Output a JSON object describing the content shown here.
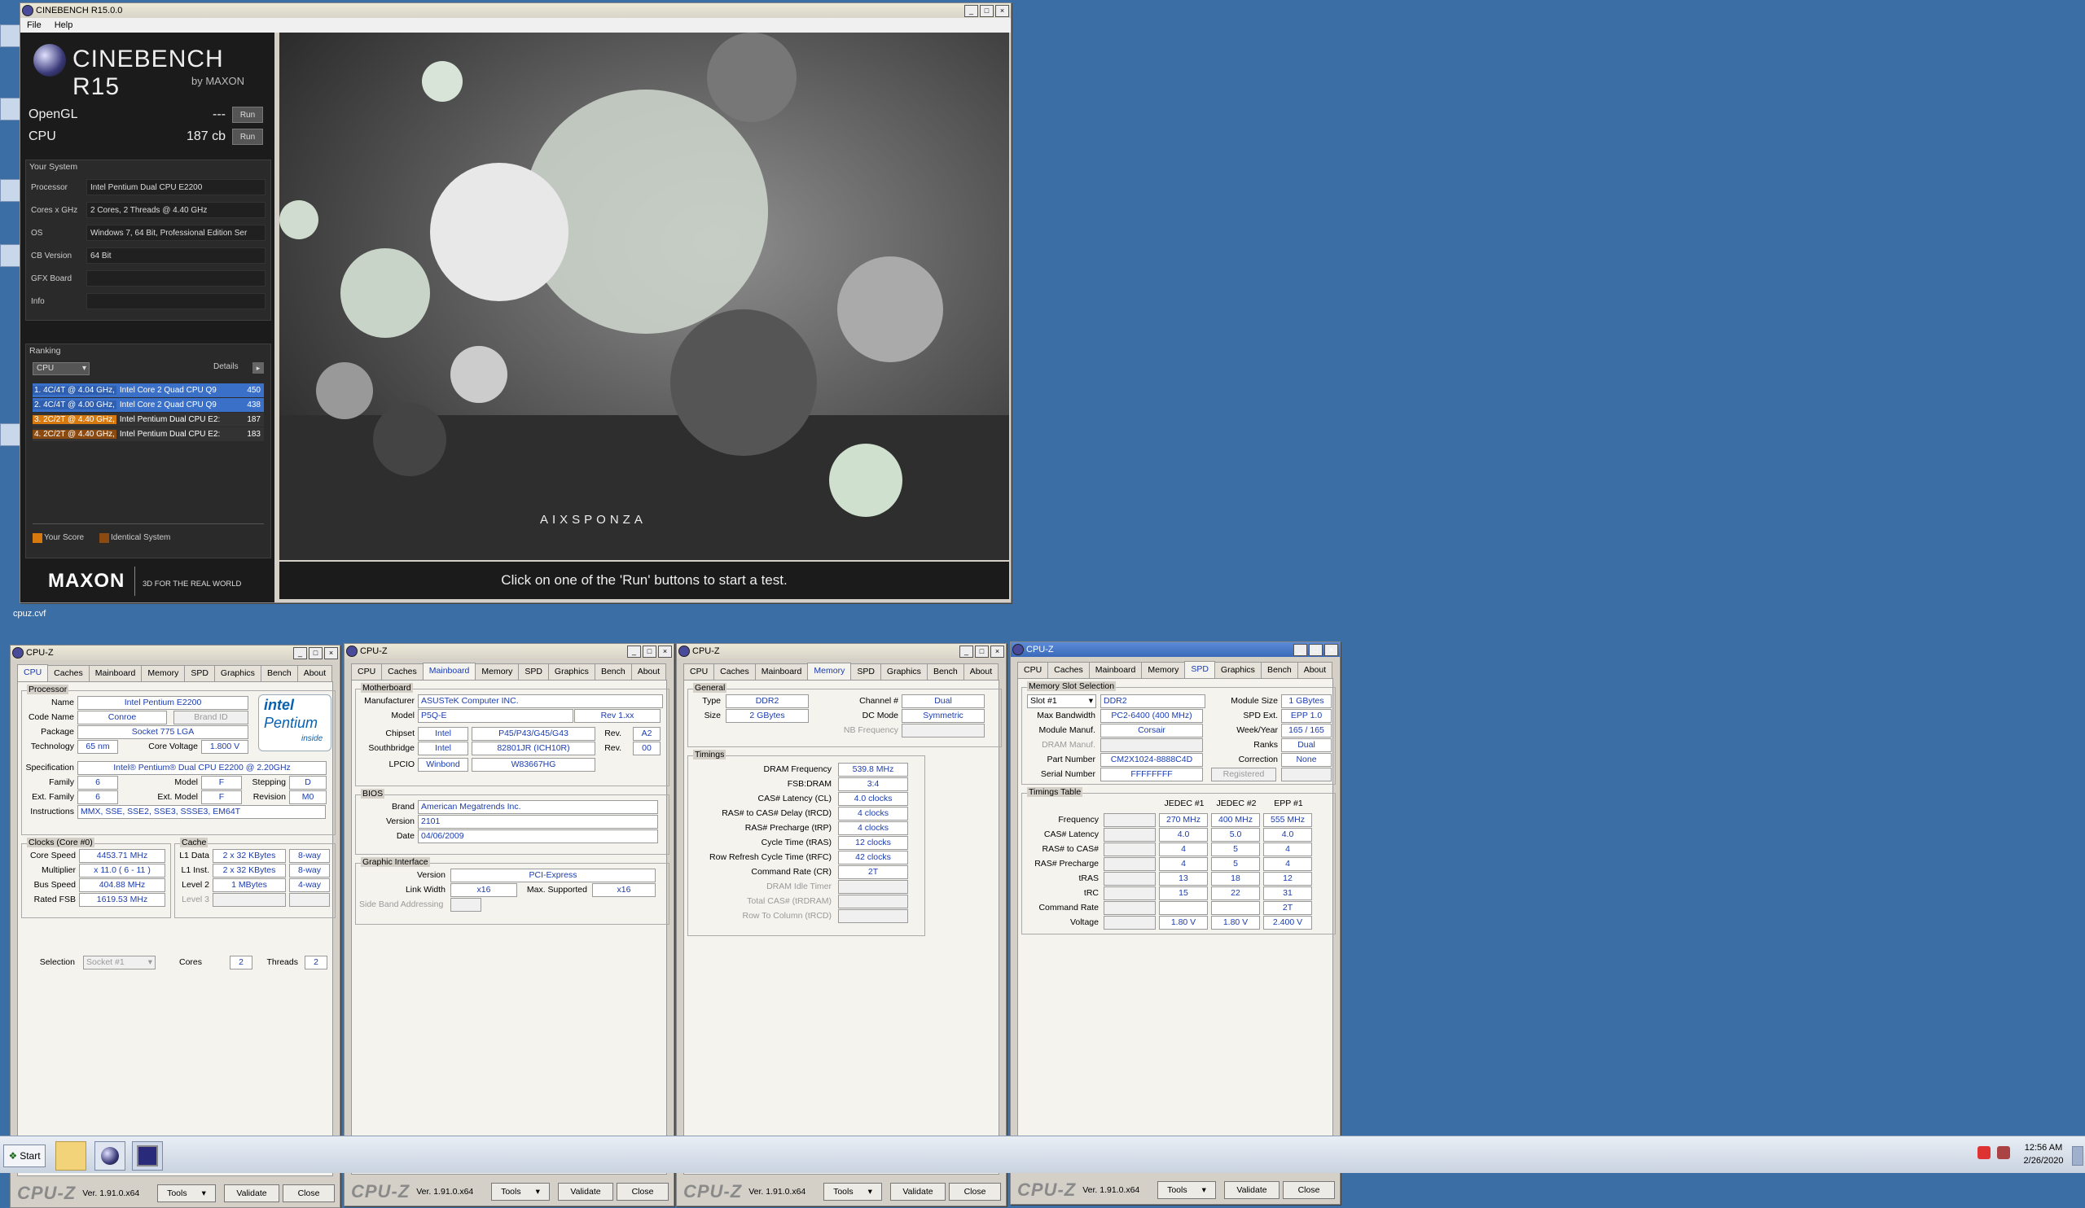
{
  "desktop": {
    "file_label": "cpuz.cvf"
  },
  "cinebench": {
    "title": "CINEBENCH R15.0.0",
    "menu": [
      "File",
      "Help"
    ],
    "logo_main": "CINEBENCH R15",
    "logo_sub": "by MAXON",
    "opengl_label": "OpenGL",
    "opengl_value": "---",
    "cpu_label": "CPU",
    "cpu_value": "187 cb",
    "run_label": "Run",
    "your_system": "Your System",
    "system": [
      {
        "k": "Processor",
        "v": "Intel Pentium Dual CPU E2200"
      },
      {
        "k": "Cores x GHz",
        "v": "2 Cores, 2 Threads @ 4.40 GHz"
      },
      {
        "k": "OS",
        "v": "Windows 7, 64 Bit, Professional Edition Ser"
      },
      {
        "k": "CB Version",
        "v": "64 Bit"
      },
      {
        "k": "GFX Board",
        "v": ""
      },
      {
        "k": "Info",
        "v": ""
      }
    ],
    "ranking_label": "Ranking",
    "ranking_select": "CPU",
    "details_label": "Details",
    "ranking": [
      {
        "hl": "1. 4C/4T @ 4.04 GHz,",
        "t": " Intel Core 2 Quad CPU Q9",
        "s": "450",
        "kind": "blue"
      },
      {
        "hl": "2. 4C/4T @ 4.00 GHz,",
        "t": " Intel Core 2 Quad CPU Q9",
        "s": "438",
        "kind": "blue"
      },
      {
        "hl": "3. 2C/2T @ 4.40 GHz,",
        "t": " Intel Pentium Dual CPU E2:",
        "s": "187",
        "kind": "orange"
      },
      {
        "hl": "4. 2C/2T @ 4.40 GHz,",
        "t": " Intel Pentium Dual CPU E2:",
        "s": "183",
        "kind": "brown"
      }
    ],
    "legend_your": "Your Score",
    "legend_ident": "Identical System",
    "maxon": "MAXON",
    "tagline": "3D FOR THE REAL WORLD",
    "status": "Click on one of the 'Run' buttons to start a test.",
    "render_credit": "AIXSPONZA"
  },
  "cpuz_common": {
    "title": "CPU-Z",
    "tabs": [
      "CPU",
      "Caches",
      "Mainboard",
      "Memory",
      "SPD",
      "Graphics",
      "Bench",
      "About"
    ],
    "logo": "CPU-Z",
    "version": "Ver. 1.91.0.x64",
    "tools": "Tools",
    "validate": "Validate",
    "close": "Close"
  },
  "cpuz_cpu": {
    "processor": "Processor",
    "name_l": "Name",
    "name": "Intel Pentium E2200",
    "codename_l": "Code Name",
    "codename": "Conroe",
    "brandid_l": "Brand ID",
    "package_l": "Package",
    "package": "Socket 775 LGA",
    "tech_l": "Technology",
    "tech": "65 nm",
    "cv_l": "Core Voltage",
    "cv": "1.800 V",
    "spec_l": "Specification",
    "spec": "Intel® Pentium® Dual  CPU  E2200  @ 2.20GHz",
    "family_l": "Family",
    "family": "6",
    "model_l": "Model",
    "model": "F",
    "stepping_l": "Stepping",
    "stepping": "D",
    "extfam_l": "Ext. Family",
    "extfam": "6",
    "extmod_l": "Ext. Model",
    "extmod": "F",
    "rev_l": "Revision",
    "rev": "M0",
    "instr_l": "Instructions",
    "instr": "MMX, SSE, SSE2, SSE3, SSSE3, EM64T",
    "clocks": "Clocks (Core #0)",
    "cs_l": "Core Speed",
    "cs": "4453.71 MHz",
    "mul_l": "Multiplier",
    "mul": "x 11.0 ( 6 - 11 )",
    "bus_l": "Bus Speed",
    "bus": "404.88 MHz",
    "fsb_l": "Rated FSB",
    "fsb": "1619.53 MHz",
    "cache": "Cache",
    "l1d_l": "L1 Data",
    "l1d": "2 x 32 KBytes",
    "l1d_w": "8-way",
    "l1i_l": "L1 Inst.",
    "l1i": "2 x 32 KBytes",
    "l1i_w": "8-way",
    "l2_l": "Level 2",
    "l2": "1 MBytes",
    "l2_w": "4-way",
    "l3_l": "Level 3",
    "sel_l": "Selection",
    "sel": "Socket #1",
    "cores_l": "Cores",
    "cores": "2",
    "threads_l": "Threads",
    "threads": "2",
    "intel_logo": "intel",
    "pentium": "Pentium",
    "inside": "inside"
  },
  "cpuz_mb": {
    "motherboard": "Motherboard",
    "manu_l": "Manufacturer",
    "manu": "ASUSTeK Computer INC.",
    "model_l": "Model",
    "model": "P5Q-E",
    "model_rev": "Rev 1.xx",
    "chipset_l": "Chipset",
    "chipset_v": "Intel",
    "chipset_m": "P45/P43/G45/G43",
    "chipset_rl": "Rev.",
    "chipset_r": "A2",
    "south_l": "Southbridge",
    "south_v": "Intel",
    "south_m": "82801JR (ICH10R)",
    "south_rl": "Rev.",
    "south_r": "00",
    "lpcio_l": "LPCIO",
    "lpcio_v": "Winbond",
    "lpcio_m": "W83667HG",
    "bios": "BIOS",
    "brand_l": "Brand",
    "brand": "American Megatrends Inc.",
    "ver_l": "Version",
    "ver": "2101",
    "date_l": "Date",
    "date": "04/06/2009",
    "gi": "Graphic Interface",
    "gver_l": "Version",
    "gver": "PCI-Express",
    "lw_l": "Link Width",
    "lw": "x16",
    "ms_l": "Max. Supported",
    "ms": "x16",
    "sba_l": "Side Band Addressing"
  },
  "cpuz_mem": {
    "general": "General",
    "type_l": "Type",
    "type": "DDR2",
    "ch_l": "Channel #",
    "ch": "Dual",
    "size_l": "Size",
    "size": "2 GBytes",
    "dc_l": "DC Mode",
    "dc": "Symmetric",
    "nb_l": "NB Frequency",
    "timings": "Timings",
    "rows": [
      {
        "l": "DRAM Frequency",
        "v": "539.8 MHz"
      },
      {
        "l": "FSB:DRAM",
        "v": "3:4"
      },
      {
        "l": "CAS# Latency (CL)",
        "v": "4.0 clocks"
      },
      {
        "l": "RAS# to CAS# Delay (tRCD)",
        "v": "4 clocks"
      },
      {
        "l": "RAS# Precharge (tRP)",
        "v": "4 clocks"
      },
      {
        "l": "Cycle Time (tRAS)",
        "v": "12 clocks"
      },
      {
        "l": "Row Refresh Cycle Time (tRFC)",
        "v": "42 clocks"
      },
      {
        "l": "Command Rate (CR)",
        "v": "2T"
      },
      {
        "l": "DRAM Idle Timer",
        "v": "",
        "dis": true
      },
      {
        "l": "Total CAS# (tRDRAM)",
        "v": "",
        "dis": true
      },
      {
        "l": "Row To Column (tRCD)",
        "v": "",
        "dis": true
      }
    ]
  },
  "cpuz_spd": {
    "mss": "Memory Slot Selection",
    "slot": "Slot #1",
    "slot_type": "DDR2",
    "msize_l": "Module Size",
    "msize": "1 GBytes",
    "mb_l": "Max Bandwidth",
    "mb": "PC2-6400 (400 MHz)",
    "spdext_l": "SPD Ext.",
    "spdext": "EPP 1.0",
    "mm_l": "Module Manuf.",
    "mm": "Corsair",
    "wy_l": "Week/Year",
    "wy": "165 / 165",
    "dm_l": "DRAM Manuf.",
    "ranks_l": "Ranks",
    "ranks": "Dual",
    "pn_l": "Part Number",
    "pn": "CM2X1024-8888C4D",
    "corr_l": "Correction",
    "corr": "None",
    "sn_l": "Serial Number",
    "sn": "FFFFFFFF",
    "reg_l": "Registered",
    "tt": "Timings Table",
    "cols": [
      "JEDEC #1",
      "JEDEC #2",
      "EPP #1"
    ],
    "trows": [
      {
        "l": "Frequency",
        "v": [
          "270 MHz",
          "400 MHz",
          "555 MHz"
        ]
      },
      {
        "l": "CAS# Latency",
        "v": [
          "4.0",
          "5.0",
          "4.0"
        ]
      },
      {
        "l": "RAS# to CAS#",
        "v": [
          "4",
          "5",
          "4"
        ]
      },
      {
        "l": "RAS# Precharge",
        "v": [
          "4",
          "5",
          "4"
        ]
      },
      {
        "l": "tRAS",
        "v": [
          "13",
          "18",
          "12"
        ]
      },
      {
        "l": "tRC",
        "v": [
          "15",
          "22",
          "31"
        ]
      },
      {
        "l": "Command Rate",
        "v": [
          "",
          "",
          "2T"
        ]
      },
      {
        "l": "Voltage",
        "v": [
          "1.80 V",
          "1.80 V",
          "2.400 V"
        ]
      }
    ]
  },
  "taskbar": {
    "start": "Start",
    "time": "12:56 AM",
    "date": "2/26/2020"
  }
}
